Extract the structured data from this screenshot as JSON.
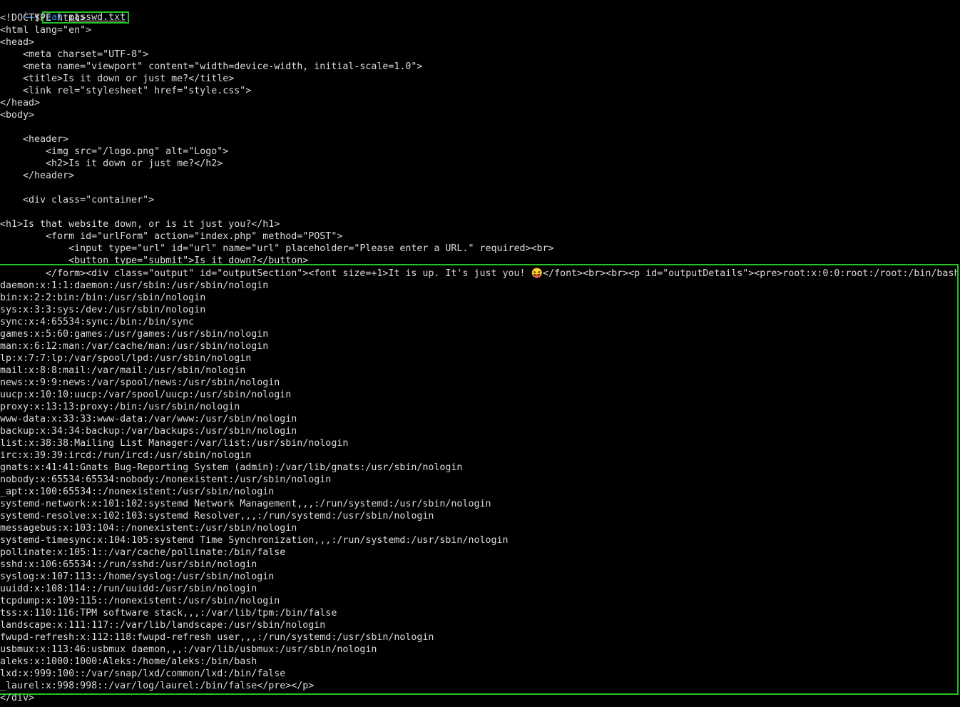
{
  "prompt": {
    "glyph": "└─",
    "dollar": "$",
    "command": "cat",
    "argument": "passwd.txt"
  },
  "source_lines": [
    "<!DOCTYPE html>",
    "<html lang=\"en\">",
    "<head>",
    "    <meta charset=\"UTF-8\">",
    "    <meta name=\"viewport\" content=\"width=device-width, initial-scale=1.0\">",
    "    <title>Is it down or just me?</title>",
    "    <link rel=\"stylesheet\" href=\"style.css\">",
    "</head>",
    "<body>",
    "",
    "    <header>",
    "        <img src=\"/logo.png\" alt=\"Logo\">",
    "        <h2>Is it down or just me?</h2>",
    "    </header>",
    "",
    "    <div class=\"container\">",
    "",
    "<h1>Is that website down, or is it just you?</h1>",
    "        <form id=\"urlForm\" action=\"index.php\" method=\"POST\">",
    "            <input type=\"url\" id=\"url\" name=\"url\" placeholder=\"Please enter a URL.\" required><br>",
    "            <button type=\"submit\">Is it down?</button>"
  ],
  "output_lines": [
    "        </form><div class=\"output\" id=\"outputSection\"><font size=+1>It is up. It's just you! 😝</font><br><br><p id=\"outputDetails\"><pre>root:x:0:0:root:/root:/bin/bash",
    "daemon:x:1:1:daemon:/usr/sbin:/usr/sbin/nologin",
    "bin:x:2:2:bin:/bin:/usr/sbin/nologin",
    "sys:x:3:3:sys:/dev:/usr/sbin/nologin",
    "sync:x:4:65534:sync:/bin:/bin/sync",
    "games:x:5:60:games:/usr/games:/usr/sbin/nologin",
    "man:x:6:12:man:/var/cache/man:/usr/sbin/nologin",
    "lp:x:7:7:lp:/var/spool/lpd:/usr/sbin/nologin",
    "mail:x:8:8:mail:/var/mail:/usr/sbin/nologin",
    "news:x:9:9:news:/var/spool/news:/usr/sbin/nologin",
    "uucp:x:10:10:uucp:/var/spool/uucp:/usr/sbin/nologin",
    "proxy:x:13:13:proxy:/bin:/usr/sbin/nologin",
    "www-data:x:33:33:www-data:/var/www:/usr/sbin/nologin",
    "backup:x:34:34:backup:/var/backups:/usr/sbin/nologin",
    "list:x:38:38:Mailing List Manager:/var/list:/usr/sbin/nologin",
    "irc:x:39:39:ircd:/run/ircd:/usr/sbin/nologin",
    "gnats:x:41:41:Gnats Bug-Reporting System (admin):/var/lib/gnats:/usr/sbin/nologin",
    "nobody:x:65534:65534:nobody:/nonexistent:/usr/sbin/nologin",
    "_apt:x:100:65534::/nonexistent:/usr/sbin/nologin",
    "systemd-network:x:101:102:systemd Network Management,,,:/run/systemd:/usr/sbin/nologin",
    "systemd-resolve:x:102:103:systemd Resolver,,,:/run/systemd:/usr/sbin/nologin",
    "messagebus:x:103:104::/nonexistent:/usr/sbin/nologin",
    "systemd-timesync:x:104:105:systemd Time Synchronization,,,:/run/systemd:/usr/sbin/nologin",
    "pollinate:x:105:1::/var/cache/pollinate:/bin/false",
    "sshd:x:106:65534::/run/sshd:/usr/sbin/nologin",
    "syslog:x:107:113::/home/syslog:/usr/sbin/nologin",
    "uuidd:x:108:114::/run/uuidd:/usr/sbin/nologin",
    "tcpdump:x:109:115::/nonexistent:/usr/sbin/nologin",
    "tss:x:110:116:TPM software stack,,,:/var/lib/tpm:/bin/false",
    "landscape:x:111:117::/var/lib/landscape:/usr/sbin/nologin",
    "fwupd-refresh:x:112:118:fwupd-refresh user,,,:/run/systemd:/usr/sbin/nologin",
    "usbmux:x:113:46:usbmux daemon,,,:/var/lib/usbmux:/usr/sbin/nologin",
    "aleks:x:1000:1000:Aleks:/home/aleks:/bin/bash",
    "lxd:x:999:100::/var/snap/lxd/common/lxd:/bin/false",
    "_laurel:x:998:998::/var/log/laurel:/bin/false</pre></p>"
  ],
  "tail_line": "</div>",
  "colors": {
    "background": "#000000",
    "text": "#dcdcdc",
    "highlight_border": "#22c322",
    "prompt_accent": "#3b8eea"
  }
}
